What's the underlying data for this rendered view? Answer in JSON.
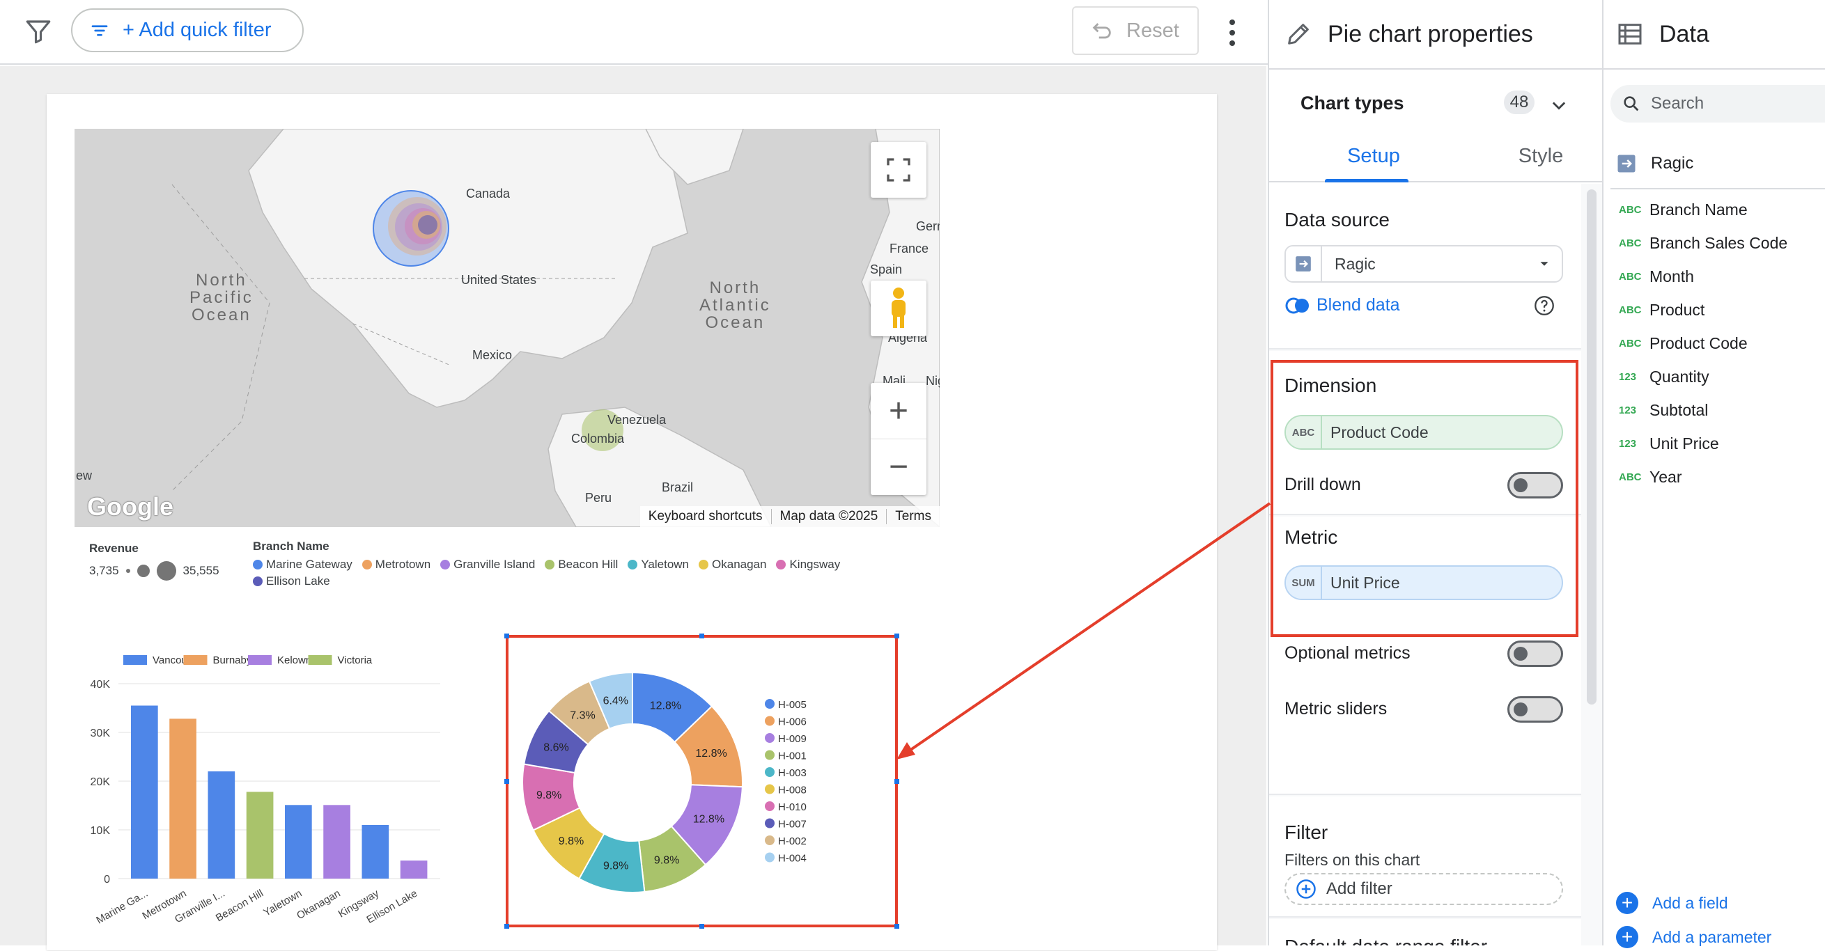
{
  "toolbar": {
    "quick_filter_label": "+ Add quick filter",
    "reset_label": "Reset"
  },
  "map": {
    "labels": [
      "Canada",
      "United States",
      "Mexico",
      "Venezuela",
      "Colombia",
      "Brazil",
      "Peru",
      "France",
      "Spain",
      "Algeria",
      "Germ",
      "Nig",
      "Mali",
      "ew"
    ],
    "ocean_pacific": [
      "North",
      "Pacific",
      "Ocean"
    ],
    "ocean_atlantic": [
      "North",
      "Atlantic",
      "Ocean"
    ],
    "google_logo": "Google",
    "footer": [
      "Keyboard shortcuts",
      "Map data ©2025",
      "Terms"
    ]
  },
  "map_legend": {
    "revenue_title": "Revenue",
    "revenue_min": "3,735",
    "revenue_max": "35,555",
    "branch_title": "Branch Name",
    "branches": [
      {
        "name": "Marine Gateway",
        "color": "#4e86e8"
      },
      {
        "name": "Metrotown",
        "color": "#eda15f"
      },
      {
        "name": "Granville Island",
        "color": "#a77fe0"
      },
      {
        "name": "Beacon Hill",
        "color": "#a9c36b"
      },
      {
        "name": "Yaletown",
        "color": "#4cb7c8"
      },
      {
        "name": "Okanagan",
        "color": "#e6c649"
      },
      {
        "name": "Kingsway",
        "color": "#d86fb2"
      },
      {
        "name": "Ellison Lake",
        "color": "#5b5cb8"
      }
    ]
  },
  "chart_data": [
    {
      "type": "bar",
      "legend": [
        {
          "name": "Vancouver",
          "color": "#4e86e8"
        },
        {
          "name": "Burnaby",
          "color": "#eda15f"
        },
        {
          "name": "Kelowna",
          "color": "#a77fe0"
        },
        {
          "name": "Victoria",
          "color": "#a9c36b"
        }
      ],
      "categories": [
        "Marine Ga...",
        "Metrotown",
        "Granville I...",
        "Beacon Hill",
        "Yaletown",
        "Okanagan",
        "Kingsway",
        "Ellison Lake"
      ],
      "values": [
        35500,
        32800,
        22000,
        17800,
        15100,
        15100,
        11000,
        3700
      ],
      "colors": [
        "#4e86e8",
        "#eda15f",
        "#4e86e8",
        "#a9c36b",
        "#4e86e8",
        "#a77fe0",
        "#4e86e8",
        "#a77fe0"
      ],
      "yticks": [
        "0",
        "10K",
        "20K",
        "30K",
        "40K"
      ],
      "ylim": [
        0,
        40000
      ]
    },
    {
      "type": "pie",
      "donut": true,
      "slices": [
        {
          "label": "H-005",
          "value": 12.8,
          "text": "12.8%",
          "color": "#4e86e8"
        },
        {
          "label": "H-006",
          "value": 12.8,
          "text": "12.8%",
          "color": "#eda15f"
        },
        {
          "label": "H-009",
          "value": 12.8,
          "text": "12.8%",
          "color": "#a77fe0"
        },
        {
          "label": "H-001",
          "value": 9.8,
          "text": "9.8%",
          "color": "#a9c36b"
        },
        {
          "label": "H-003",
          "value": 9.8,
          "text": "9.8%",
          "color": "#4cb7c8"
        },
        {
          "label": "H-008",
          "value": 9.8,
          "text": "9.8%",
          "color": "#e6c649"
        },
        {
          "label": "H-010",
          "value": 9.8,
          "text": "9.8%",
          "color": "#d86fb2"
        },
        {
          "label": "H-007",
          "value": 8.6,
          "text": "8.6%",
          "color": "#5b5cb8"
        },
        {
          "label": "H-002",
          "value": 7.3,
          "text": "7.3%",
          "color": "#d9b98a"
        },
        {
          "label": "H-004",
          "value": 6.4,
          "text": "6.4%",
          "color": "#a6d0f0"
        }
      ]
    }
  ],
  "properties": {
    "title": "Pie chart properties",
    "chart_types_label": "Chart types",
    "chart_types_count": "48",
    "tab_setup": "Setup",
    "tab_style": "Style",
    "data_source_title": "Data source",
    "data_source_value": "Ragic",
    "blend_data": "Blend data",
    "dimension_title": "Dimension",
    "dimension_type": "ABC",
    "dimension_value": "Product Code",
    "drill_down": "Drill down",
    "metric_title": "Metric",
    "metric_type": "SUM",
    "metric_value": "Unit Price",
    "optional_metrics": "Optional metrics",
    "metric_sliders": "Metric sliders",
    "filter_title": "Filter",
    "filter_sub": "Filters on this chart",
    "add_filter": "Add filter",
    "default_date_title": "Default date range filter"
  },
  "data_panel": {
    "title": "Data",
    "search_placeholder": "Search",
    "source": "Ragic",
    "fields": [
      {
        "type": "ABC",
        "name": "Branch Name"
      },
      {
        "type": "ABC",
        "name": "Branch Sales Code"
      },
      {
        "type": "ABC",
        "name": "Month"
      },
      {
        "type": "ABC",
        "name": "Product"
      },
      {
        "type": "ABC",
        "name": "Product Code"
      },
      {
        "type": "123",
        "name": "Quantity"
      },
      {
        "type": "123",
        "name": "Subtotal"
      },
      {
        "type": "123",
        "name": "Unit Price"
      },
      {
        "type": "ABC",
        "name": "Year"
      }
    ],
    "add_field": "Add a field",
    "add_parameter": "Add a parameter"
  }
}
